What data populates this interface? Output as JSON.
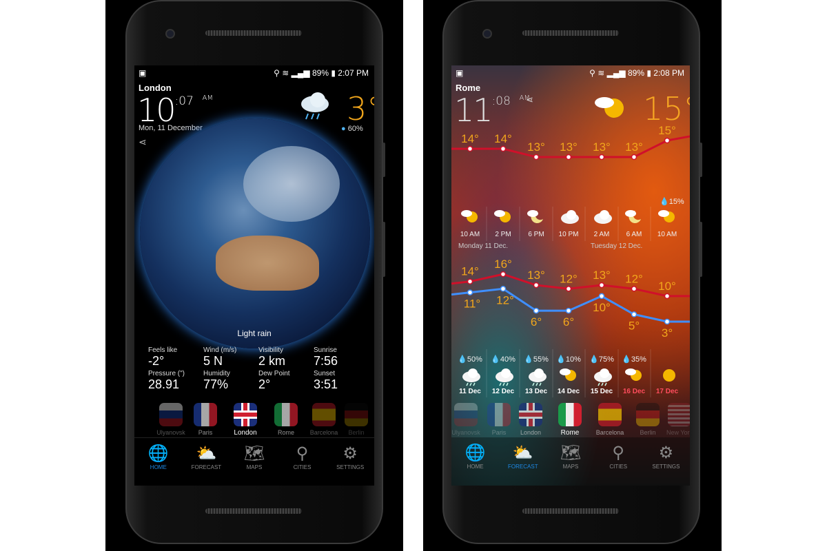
{
  "left": {
    "status": {
      "time": "2:07 PM",
      "battery": "89%"
    },
    "city": "London",
    "time_hm": "10",
    "time_min": ":07",
    "ampm": "AM",
    "date": "Mon, 11 December",
    "temp": "3°",
    "precip": "60%",
    "condition": "Light rain",
    "stats": [
      {
        "label": "Feels like",
        "value": "-2°"
      },
      {
        "label": "Wind (m/s)",
        "value": "5 N"
      },
      {
        "label": "Visibility",
        "value": "2 km"
      },
      {
        "label": "Sunrise",
        "value": "7:56"
      },
      {
        "label": "Pressure (\")",
        "value": "28.91"
      },
      {
        "label": "Humidity",
        "value": "77%"
      },
      {
        "label": "Dew Point",
        "value": "2°"
      },
      {
        "label": "Sunset",
        "value": "3:51"
      }
    ],
    "cities": [
      "Ulyanovsk",
      "Paris",
      "London",
      "Rome",
      "Barcelona",
      "Berlin"
    ],
    "active_city": "London",
    "nav": [
      "HOME",
      "FORECAST",
      "MAPS",
      "CITIES",
      "SETTINGS"
    ],
    "active_nav": "HOME"
  },
  "right": {
    "status": {
      "time": "2:08 PM",
      "battery": "89%"
    },
    "city": "Rome",
    "time_hm": "11",
    "time_min": ":08",
    "ampm": "AM",
    "temp": "15°",
    "hourly": {
      "temps": [
        14,
        14,
        13,
        13,
        13,
        13,
        15
      ],
      "times": [
        "10 AM",
        "2 PM",
        "6 PM",
        "10 PM",
        "2 AM",
        "6 AM",
        "10 AM"
      ],
      "icons": [
        "partly-sunny",
        "partly-sunny",
        "moon-cloud",
        "cloud",
        "cloud",
        "moon-cloud",
        "partly-sunny"
      ],
      "precip_label": "15%",
      "days": [
        "Monday 11 Dec.",
        "Tuesday 12 Dec."
      ]
    },
    "daily": {
      "highs": [
        14,
        16,
        13,
        12,
        13,
        12,
        10
      ],
      "lows": [
        11,
        12,
        6,
        6,
        10,
        5,
        3
      ],
      "precip": [
        "50%",
        "40%",
        "55%",
        "10%",
        "75%",
        "35%",
        ""
      ],
      "dates": [
        "11 Dec",
        "12 Dec",
        "13 Dec",
        "14 Dec",
        "15 Dec",
        "16 Dec",
        "17 Dec"
      ],
      "icons": [
        "sun-cloud-rain",
        "sun-cloud-rain",
        "sun-cloud-rain",
        "partly-sunny",
        "cloud-rain",
        "partly-sunny",
        "sunny"
      ]
    },
    "cities": [
      "Ulyanovsk",
      "Paris",
      "London",
      "Rome",
      "Barcelona",
      "Berlin",
      "New York"
    ],
    "active_city": "Rome",
    "nav": [
      "HOME",
      "FORECAST",
      "MAPS",
      "CITIES",
      "SETTINGS"
    ],
    "active_nav": "FORECAST"
  },
  "colors": {
    "accent": "#1e88e5",
    "temp": "#f1a61c",
    "high_line": "#d0102a",
    "low_line": "#3f8fff",
    "weekend": "#ff4d5e"
  }
}
